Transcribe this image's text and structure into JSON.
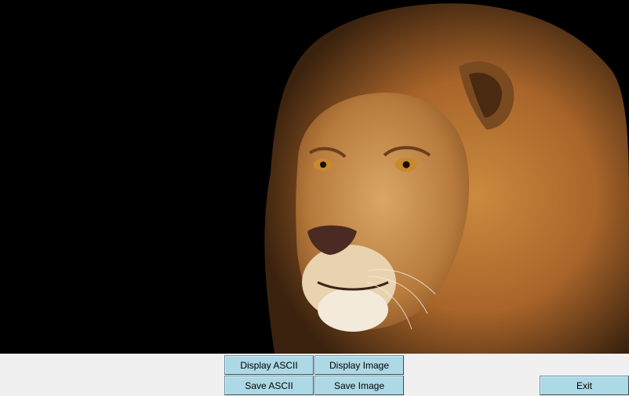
{
  "image_panel": {
    "subject": "lion-photo"
  },
  "buttons": {
    "display_ascii": "Display ASCII",
    "display_image": "Display Image",
    "save_ascii": "Save ASCII",
    "save_image": "Save Image",
    "exit": "Exit"
  },
  "colors": {
    "button_bg": "#add8e6",
    "canvas_bg": "#000000",
    "window_bg": "#f0f0f0"
  }
}
